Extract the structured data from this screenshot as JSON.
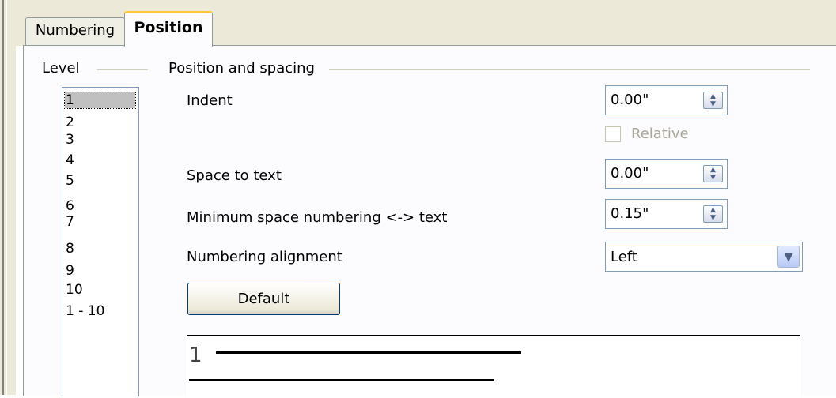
{
  "tabs": {
    "numbering": "Numbering",
    "position": "Position"
  },
  "level": {
    "title": "Level",
    "items": [
      "1",
      "2",
      "3",
      "4",
      "5",
      "6",
      "7",
      "8",
      "9",
      "10",
      "1 - 10"
    ],
    "selected": "1"
  },
  "position_spacing": {
    "title": "Position and spacing",
    "indent_label": "Indent",
    "indent_value": "0.00\"",
    "relative_label": "Relative",
    "relative_checked": false,
    "space_to_text_label": "Space to text",
    "space_to_text_value": "0.00\"",
    "min_space_label": "Minimum space numbering <-> text",
    "min_space_value": "0.15\"",
    "alignment_label": "Numbering alignment",
    "alignment_value": "Left",
    "default_button": "Default"
  },
  "preview": {
    "number": "1"
  }
}
